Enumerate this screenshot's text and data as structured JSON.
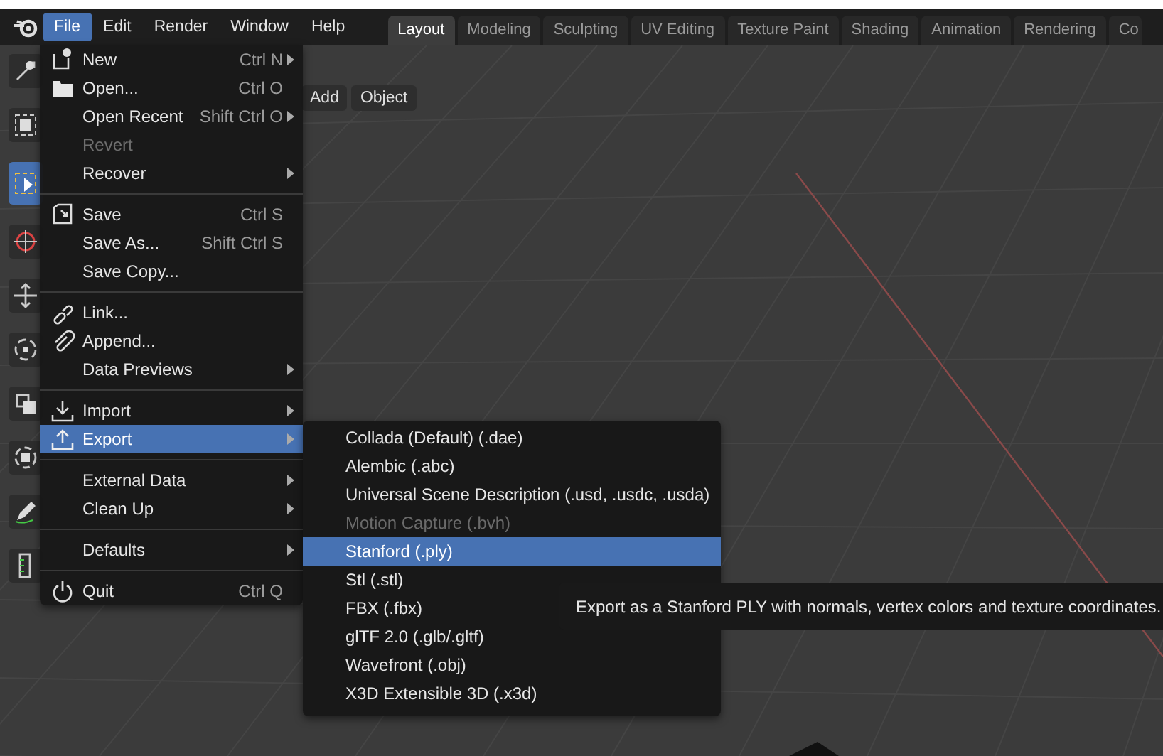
{
  "top_bar": {
    "menus": [
      {
        "label": "File",
        "selected": true
      },
      {
        "label": "Edit",
        "selected": false
      },
      {
        "label": "Render",
        "selected": false
      },
      {
        "label": "Window",
        "selected": false
      },
      {
        "label": "Help",
        "selected": false
      }
    ],
    "tabs": [
      {
        "label": "Layout",
        "selected": true
      },
      {
        "label": "Modeling",
        "selected": false
      },
      {
        "label": "Sculpting",
        "selected": false
      },
      {
        "label": "UV Editing",
        "selected": false
      },
      {
        "label": "Texture Paint",
        "selected": false
      },
      {
        "label": "Shading",
        "selected": false
      },
      {
        "label": "Animation",
        "selected": false
      },
      {
        "label": "Rendering",
        "selected": false
      },
      {
        "label": "Co",
        "selected": false
      }
    ]
  },
  "viewport": {
    "header_buttons": [
      "Add",
      "Object"
    ],
    "tools": [
      {
        "kind": "cursor",
        "selected": false
      },
      {
        "kind": "select",
        "selected": false
      },
      {
        "kind": "select-box",
        "selected": true
      },
      {
        "kind": "cursor-3d",
        "selected": false
      },
      {
        "kind": "move",
        "selected": false
      },
      {
        "kind": "rotate",
        "selected": false
      },
      {
        "kind": "scale",
        "selected": false
      },
      {
        "kind": "transform",
        "selected": false
      },
      {
        "kind": "annotate",
        "selected": false
      },
      {
        "kind": "measure",
        "selected": false
      }
    ]
  },
  "file_menu": {
    "sections": [
      [
        {
          "label": "New",
          "shortcut": "Ctrl N",
          "submenu": true,
          "disabled": false,
          "selected": false,
          "kind": "new"
        },
        {
          "label": "Open...",
          "shortcut": "Ctrl O",
          "submenu": false,
          "disabled": false,
          "selected": false,
          "kind": "folder"
        },
        {
          "label": "Open Recent",
          "shortcut": "Shift Ctrl O",
          "submenu": true,
          "disabled": false,
          "selected": false,
          "kind": "plain"
        },
        {
          "label": "Revert",
          "submenu": false,
          "disabled": true,
          "selected": false,
          "kind": "plain"
        },
        {
          "label": "Recover",
          "submenu": true,
          "disabled": false,
          "selected": false,
          "kind": "plain"
        }
      ],
      [
        {
          "label": "Save",
          "shortcut": "Ctrl S",
          "submenu": false,
          "disabled": false,
          "selected": false,
          "kind": "save"
        },
        {
          "label": "Save As...",
          "shortcut": "Shift Ctrl S",
          "submenu": false,
          "disabled": false,
          "selected": false,
          "kind": "plain"
        },
        {
          "label": "Save Copy...",
          "submenu": false,
          "disabled": false,
          "selected": false,
          "kind": "plain"
        }
      ],
      [
        {
          "label": "Link...",
          "submenu": false,
          "disabled": false,
          "selected": false,
          "kind": "link"
        },
        {
          "label": "Append...",
          "submenu": false,
          "disabled": false,
          "selected": false,
          "kind": "paperclip"
        },
        {
          "label": "Data Previews",
          "submenu": true,
          "disabled": false,
          "selected": false,
          "kind": "plain"
        }
      ],
      [
        {
          "label": "Import",
          "submenu": true,
          "disabled": false,
          "selected": false,
          "kind": "import"
        },
        {
          "label": "Export",
          "submenu": true,
          "disabled": false,
          "selected": true,
          "kind": "export"
        }
      ],
      [
        {
          "label": "External Data",
          "submenu": true,
          "disabled": false,
          "selected": false,
          "kind": "plain"
        },
        {
          "label": "Clean Up",
          "submenu": true,
          "disabled": false,
          "selected": false,
          "kind": "plain"
        }
      ],
      [
        {
          "label": "Defaults",
          "submenu": true,
          "disabled": false,
          "selected": false,
          "kind": "plain"
        }
      ],
      [
        {
          "label": "Quit",
          "shortcut": "Ctrl Q",
          "submenu": false,
          "disabled": false,
          "selected": false,
          "kind": "power"
        }
      ]
    ]
  },
  "export_menu": {
    "items": [
      {
        "label": "Collada (Default) (.dae)",
        "disabled": false,
        "selected": false
      },
      {
        "label": "Alembic (.abc)",
        "disabled": false,
        "selected": false
      },
      {
        "label": "Universal Scene Description (.usd, .usdc, .usda)",
        "disabled": false,
        "selected": false
      },
      {
        "label": "Motion Capture (.bvh)",
        "disabled": true,
        "selected": false
      },
      {
        "label": "Stanford (.ply)",
        "disabled": false,
        "selected": true
      },
      {
        "label": "Stl (.stl)",
        "disabled": false,
        "selected": false
      },
      {
        "label": "FBX (.fbx)",
        "disabled": false,
        "selected": false
      },
      {
        "label": "glTF 2.0 (.glb/.gltf)",
        "disabled": false,
        "selected": false
      },
      {
        "label": "Wavefront (.obj)",
        "disabled": false,
        "selected": false
      },
      {
        "label": "X3D Extensible 3D (.x3d)",
        "disabled": false,
        "selected": false
      }
    ]
  },
  "tooltip": {
    "text": "Export as a Stanford PLY with normals, vertex colors and texture coordinates."
  }
}
